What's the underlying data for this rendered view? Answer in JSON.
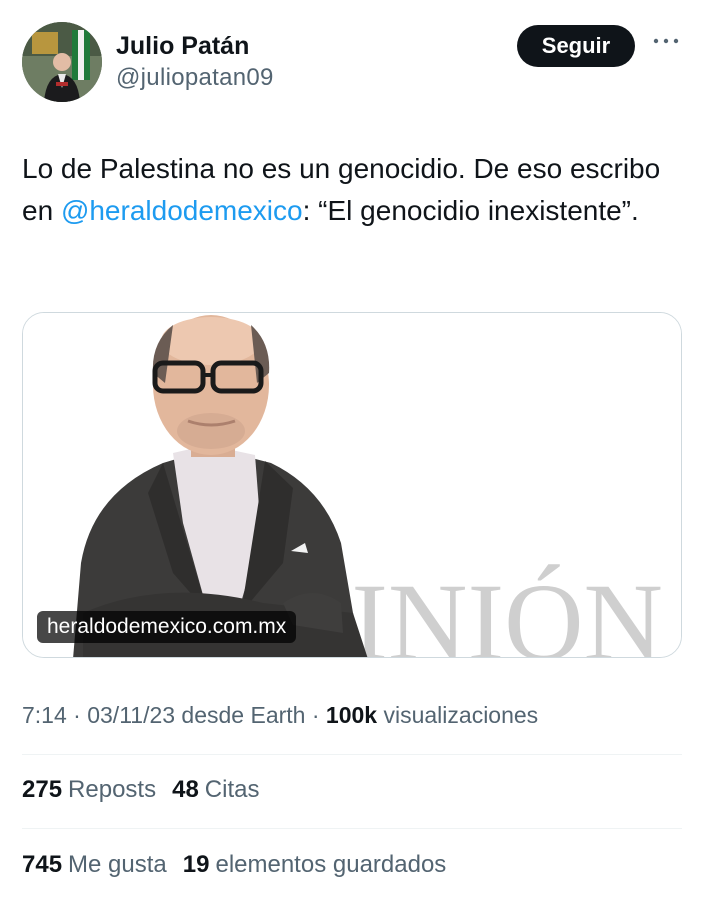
{
  "author": {
    "name": "Julio Patán",
    "handle": "@juliopatan09",
    "follow_label": "Seguir"
  },
  "tweet": {
    "text_before": "Lo de Palestina no es un genocidio. De eso escribo en ",
    "mention": "@heraldodemexico",
    "text_after": ": “El genocidio inexistente”."
  },
  "card": {
    "domain": "heraldodemexico.com.mx",
    "watermark": "PINIÓN"
  },
  "meta": {
    "time": "7:14",
    "sep1": " · ",
    "date": "03/11/23",
    "source": " desde Earth",
    "sep2": " · ",
    "views": "100k",
    "views_label": " visualizaciones"
  },
  "stats": {
    "reposts": "275",
    "reposts_label": "Reposts",
    "quotes": "48",
    "quotes_label": "Citas",
    "likes": "745",
    "likes_label": "Me gusta",
    "bookmarks": "19",
    "bookmarks_label": "elementos guardados"
  },
  "colors": {
    "link": "#1d9bf0",
    "muted": "#536471",
    "text": "#0f1419",
    "divider": "#eff3f4"
  },
  "icons": {
    "more": "more-dots-icon"
  }
}
